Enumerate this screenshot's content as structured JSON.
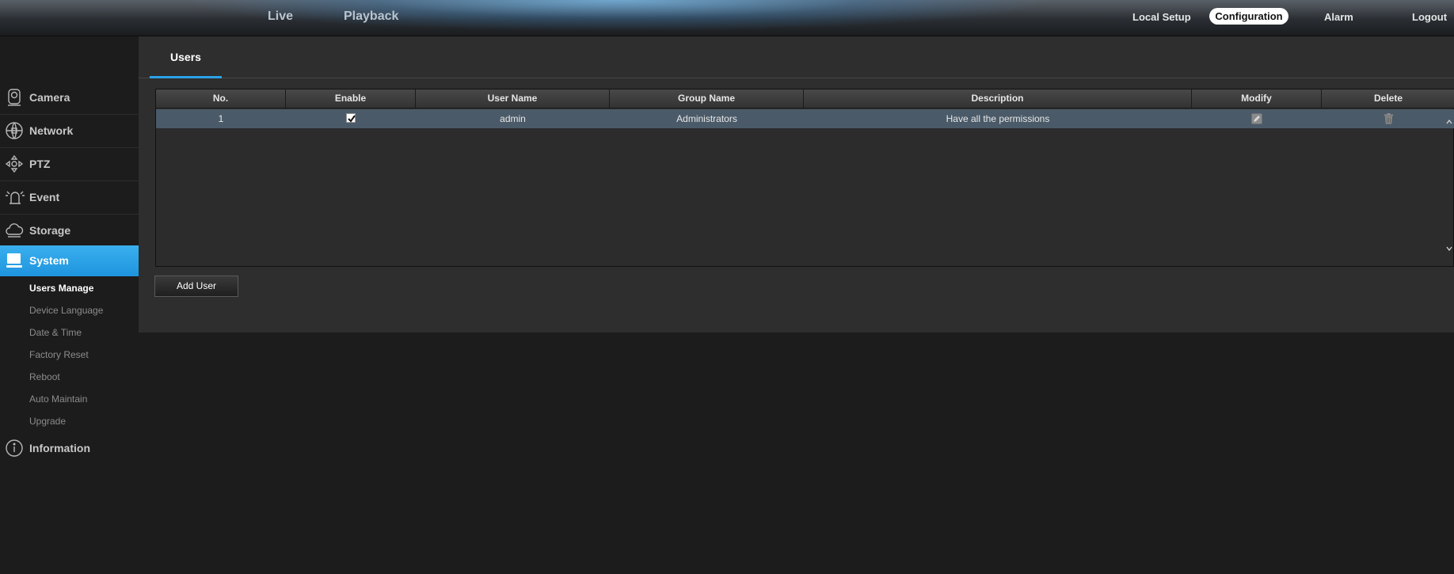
{
  "topnav": {
    "live": "Live",
    "playback": "Playback",
    "local_setup": "Local Setup",
    "configuration": "Configuration",
    "alarm": "Alarm",
    "logout": "Logout"
  },
  "sidebar": {
    "items": [
      {
        "label": "Camera",
        "icon": "camera-icon"
      },
      {
        "label": "Network",
        "icon": "network-icon"
      },
      {
        "label": "PTZ",
        "icon": "ptz-icon"
      },
      {
        "label": "Event",
        "icon": "event-icon"
      },
      {
        "label": "Storage",
        "icon": "storage-icon"
      },
      {
        "label": "System",
        "icon": "system-icon"
      }
    ],
    "system_sub": [
      "Users Manage",
      "Device Language",
      "Date & Time",
      "Factory Reset",
      "Reboot",
      "Auto Maintain",
      "Upgrade"
    ],
    "information": {
      "label": "Information",
      "icon": "info-icon"
    }
  },
  "content": {
    "tab": "Users",
    "table": {
      "headers": [
        "No.",
        "Enable",
        "User Name",
        "Group Name",
        "Description",
        "Modify",
        "Delete"
      ],
      "rows": [
        {
          "no": "1",
          "enabled": true,
          "user_name": "admin",
          "group_name": "Administrators",
          "description": "Have all the permissions"
        }
      ]
    },
    "add_user": "Add User"
  },
  "colors": {
    "accent": "#2aa2e6",
    "row_highlight": "#4a5a68",
    "panel": "#2e2e2e"
  }
}
